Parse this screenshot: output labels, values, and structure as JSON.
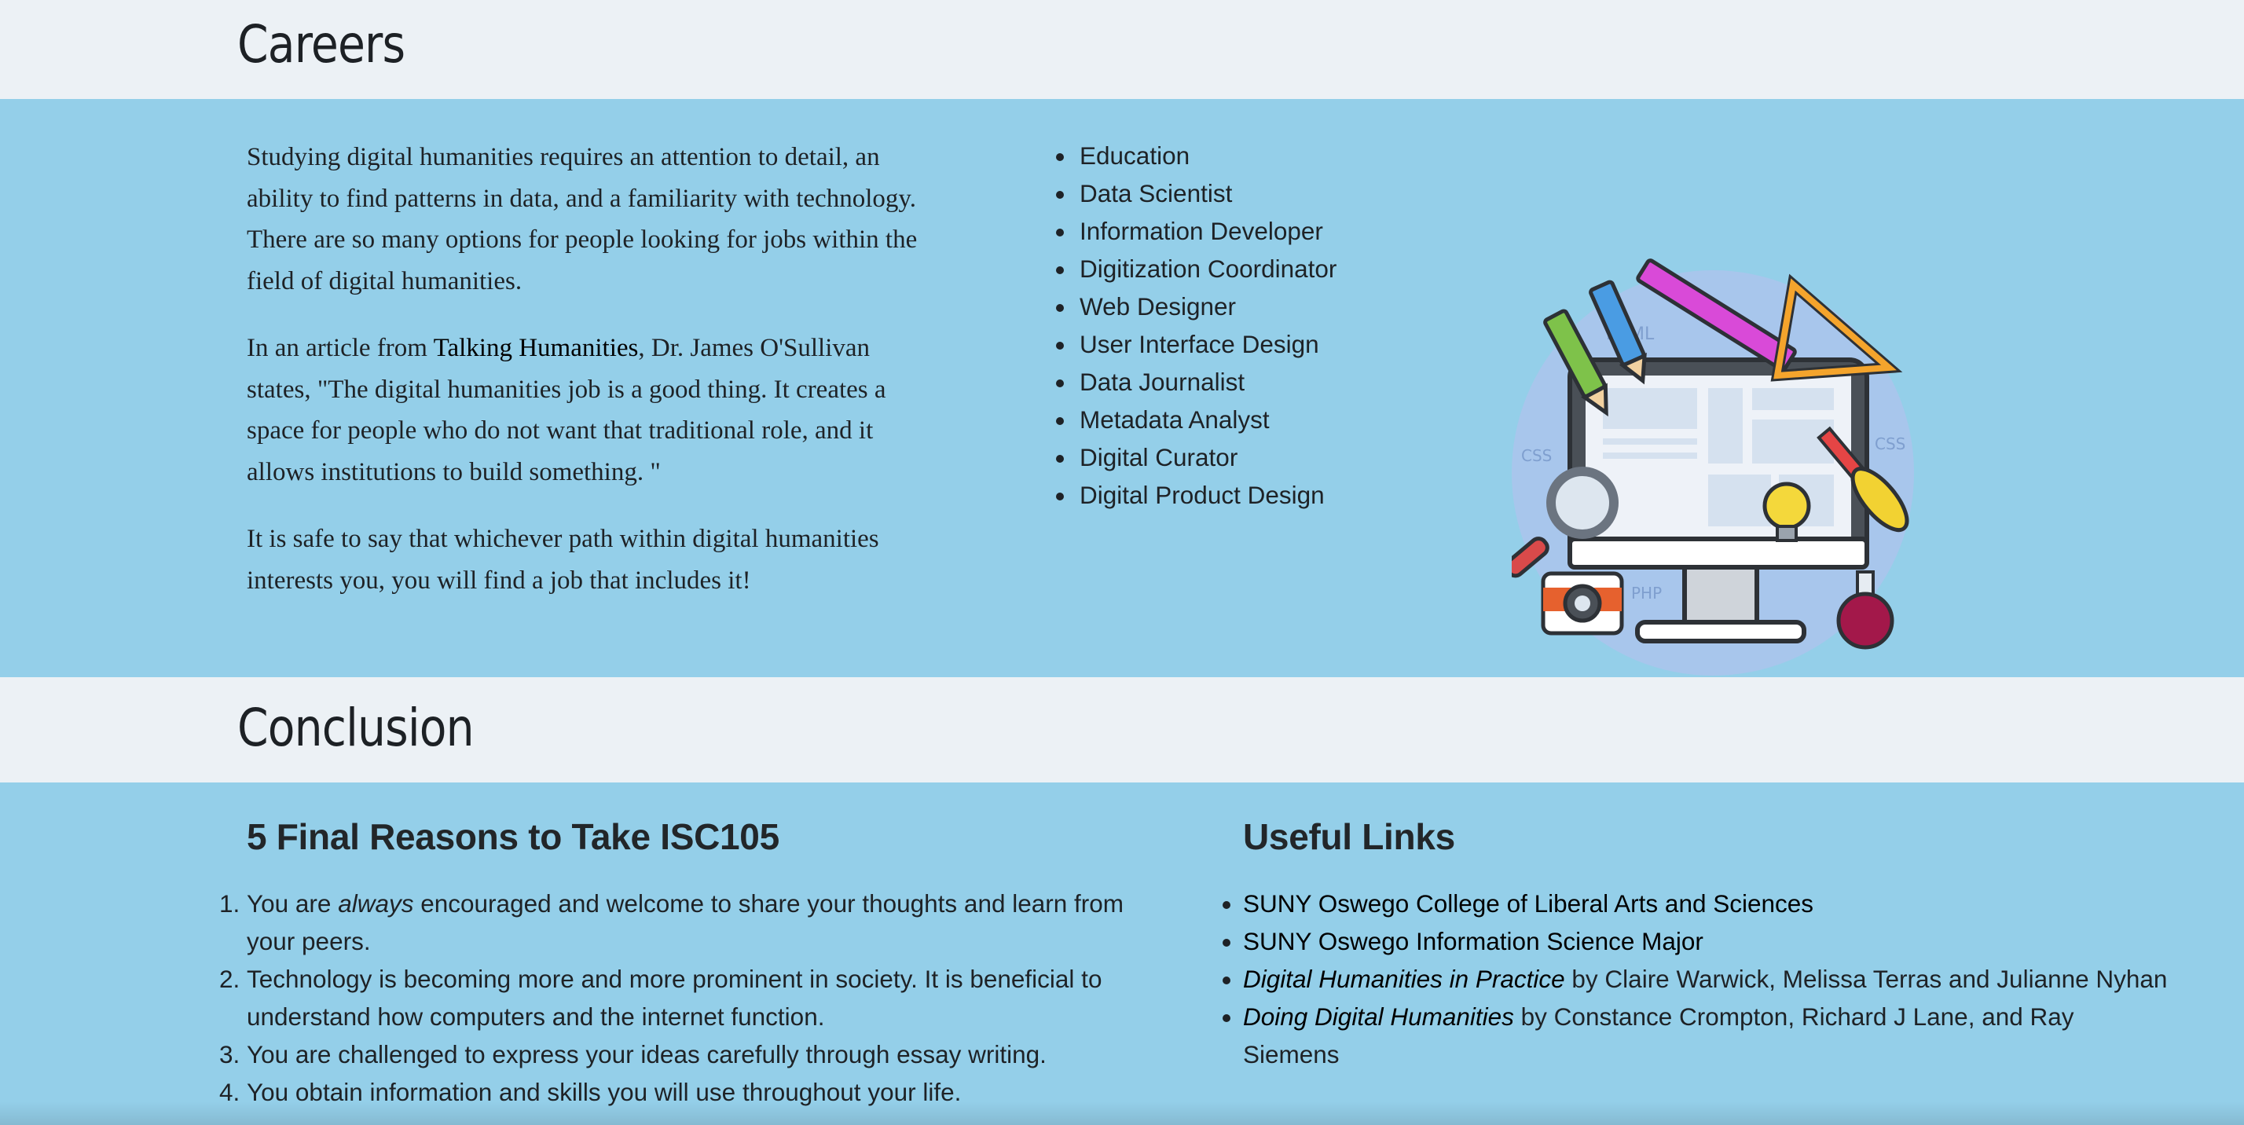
{
  "careers": {
    "heading": "Careers",
    "para1": "Studying digital humanities requires an attention to detail, an ability to find patterns in data, and a familiarity with technology. There are so many options for people looking for jobs within the field of digital humanities.",
    "para2_before": "In an article from ",
    "para2_link": "Talking Humanities",
    "para2_after": ", Dr. James O'Sullivan states, \"The digital humanities job is a good thing. It creates a space for people who do not want that traditional role, and it allows institutions to build something. \"",
    "para3": "It is safe to say that whichever path within digital humanities interests you, you will find a job that includes it!",
    "jobs": [
      "Education",
      "Data Scientist",
      "Information Developer",
      "Digitization Coordinator",
      "Web Designer",
      "User Interface Design",
      "Data Journalist",
      "Metadata Analyst",
      "Digital Curator",
      "Digital Product Design"
    ],
    "illustration_icon": "web-design-illustration",
    "illustration_labels": {
      "html": "HTML",
      "css1": "CSS",
      "css2": "CSS",
      "php": "PHP"
    }
  },
  "conclusion": {
    "heading": "Conclusion",
    "reasons_title": "5 Final Reasons to Take ISC105",
    "reasons": [
      {
        "before": "You are ",
        "em": "always",
        "after": " encouraged and welcome to share your thoughts and learn from your peers."
      },
      {
        "before": "Technology is becoming more and more prominent in society. It is beneficial to understand how computers and the internet function.",
        "em": "",
        "after": ""
      },
      {
        "before": "You are challenged to express your ideas carefully through essay writing.",
        "em": "",
        "after": ""
      },
      {
        "before": "You obtain information and skills you will use throughout your life.",
        "em": "",
        "after": ""
      }
    ],
    "links_title": "Useful Links",
    "links": [
      {
        "em": "",
        "text": "SUNY Oswego College of Liberal Arts and Sciences"
      },
      {
        "em": "",
        "text": "SUNY Oswego Information Science Major"
      },
      {
        "em": "Digital Humanities in Practice",
        "text": " by Claire Warwick, Melissa Terras and Julianne Nyhan"
      },
      {
        "em": "Doing Digital Humanities",
        "text": " by Constance Crompton, Richard J Lane, and Ray Siemens"
      }
    ]
  },
  "colors": {
    "header_bg": "#ecf1f5",
    "band_bg": "#94cfe9",
    "text": "#1e2226"
  }
}
